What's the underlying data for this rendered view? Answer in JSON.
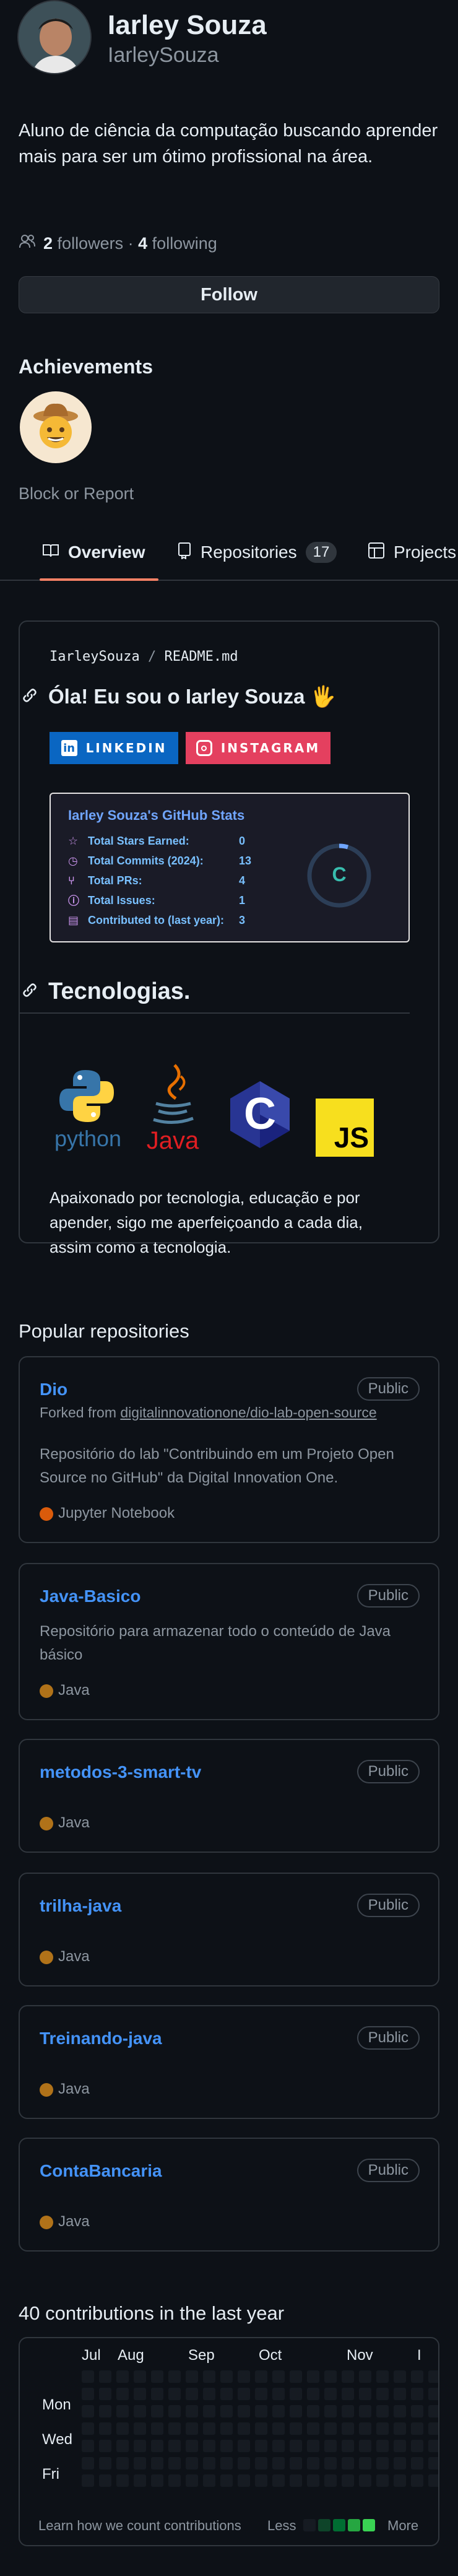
{
  "profile": {
    "name": "Iarley Souza",
    "username": "IarleySouza",
    "bio": "Aluno de ciência da computação buscando aprender mais para ser um ótimo profissional na área.",
    "followers_count": "2",
    "followers_label": "followers",
    "following_count": "4",
    "following_label": "following",
    "separator": "·",
    "follow_label": "Follow",
    "achievements_title": "Achievements",
    "block_label": "Block or Report"
  },
  "tabs": [
    {
      "label": "Overview",
      "icon": "book-icon",
      "active": true
    },
    {
      "label": "Repositories",
      "icon": "repo-icon",
      "count": "17"
    },
    {
      "label": "Projects",
      "icon": "table-icon"
    }
  ],
  "readme": {
    "path_owner": "IarleySouza",
    "path_sep": "/",
    "path_file": "README.md",
    "heading": "Óla! Eu sou o Iarley Souza 🖐",
    "linkedin_label": "LINKEDIN",
    "instagram_label": "INSTAGRAM",
    "stats": {
      "title": "Iarley Souza's GitHub Stats",
      "grade": "C",
      "rows": [
        {
          "label": "Total Stars Earned:",
          "value": "0",
          "icon": "star-icon"
        },
        {
          "label": "Total Commits (2024):",
          "value": "13",
          "icon": "clock-icon"
        },
        {
          "label": "Total PRs:",
          "value": "4",
          "icon": "pr-icon"
        },
        {
          "label": "Total Issues:",
          "value": "1",
          "icon": "issue-icon"
        },
        {
          "label": "Contributed to (last year):",
          "value": "3",
          "icon": "repo-icon"
        }
      ]
    },
    "tech_heading": "Tecnologias.",
    "tech_icons": [
      "python",
      "java",
      "C",
      "JS"
    ],
    "python_label": "python",
    "java_label": "Java",
    "c_label": "C",
    "js_label": "JS",
    "paragraph": "Apaixonado por tecnologia, educação e por apender, sigo me aperfeiçoando a cada dia, assim como a tecnologia."
  },
  "popular": {
    "title": "Popular repositories",
    "repos": [
      {
        "name": "Dio",
        "badge": "Public",
        "forked_prefix": "Forked from ",
        "forked_from": "digitalinnovationone/dio-lab-open-source",
        "description": "Repositório do lab \"Contribuindo em um Projeto Open Source no GitHub\" da Digital Innovation One.",
        "language": "Jupyter Notebook",
        "lang_color": "#da5b0b"
      },
      {
        "name": "Java-Basico",
        "badge": "Public",
        "description": "Repositório para armazenar todo o conteúdo de Java básico",
        "language": "Java",
        "lang_color": "#b07219"
      },
      {
        "name": "metodos-3-smart-tv",
        "badge": "Public",
        "language": "Java",
        "lang_color": "#b07219"
      },
      {
        "name": "trilha-java",
        "badge": "Public",
        "language": "Java",
        "lang_color": "#b07219"
      },
      {
        "name": "Treinando-java",
        "badge": "Public",
        "language": "Java",
        "lang_color": "#b07219"
      },
      {
        "name": "ContaBancaria",
        "badge": "Public",
        "language": "Java",
        "lang_color": "#b07219"
      }
    ]
  },
  "contributions": {
    "title": "40 contributions in the last year",
    "months": [
      "Jul",
      "Aug",
      "Sep",
      "Oct",
      "Nov",
      "I"
    ],
    "days": [
      "Mon",
      "Wed",
      "Fri"
    ],
    "learn_label": "Learn how we count contributions",
    "less_label": "Less",
    "more_label": "More",
    "legend_colors": [
      "#161b22",
      "#0e4429",
      "#006d32",
      "#26a641",
      "#39d353"
    ]
  }
}
